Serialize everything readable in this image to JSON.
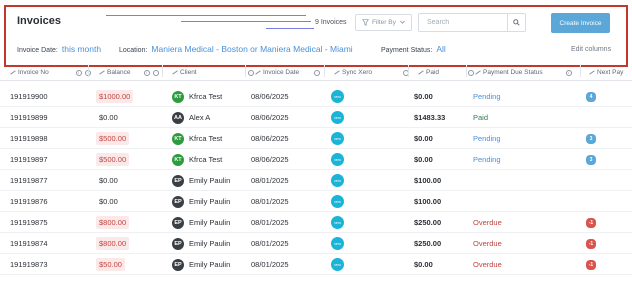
{
  "header": {
    "title": "Invoices",
    "count_label": "9 Invoices",
    "filter_label": "Filter By",
    "search_placeholder": "Search",
    "create_label": "Create Invoice",
    "filters": {
      "invoice_date_label": "Invoice Date:",
      "invoice_date_value": "this month",
      "location_label": "Location:",
      "location_value": "Maniera Medical - Boston or Maniera Medical - Miami",
      "payment_status_label": "Payment Status:",
      "payment_status_value": "All"
    },
    "edit_columns_label": "Edit columns"
  },
  "columns": [
    "Invoice No",
    "Balance",
    "Client",
    "Invoice Date",
    "Sync Xero",
    "Paid",
    "Payment Due Status",
    "Next Pay"
  ],
  "xero_label": "xero",
  "colors": {
    "accent": "#5aa7d8",
    "overdue": "#c2453f",
    "pending": "#4a90d9",
    "paid": "#2e7d4f",
    "avatar_green": "#2e9b3e",
    "avatar_dark": "#3a3f45"
  },
  "rows": [
    {
      "invoice_no": "191919900",
      "balance": "$1000.00",
      "balance_due": true,
      "initials": "KT",
      "avatar": "green",
      "client": "Kfrca Test",
      "date": "08/06/2025",
      "paid": "$0.00",
      "status": "Pending",
      "status_kind": "pending",
      "badge": "4",
      "badge_kind": "blue"
    },
    {
      "invoice_no": "191919899",
      "balance": "$0.00",
      "balance_due": false,
      "initials": "AA",
      "avatar": "dark",
      "client": "Alex A",
      "date": "08/06/2025",
      "paid": "$1483.33",
      "status": "Paid",
      "status_kind": "paid",
      "badge": "",
      "badge_kind": ""
    },
    {
      "invoice_no": "191919898",
      "balance": "$500.00",
      "balance_due": true,
      "initials": "KT",
      "avatar": "green",
      "client": "Kfrca Test",
      "date": "08/06/2025",
      "paid": "$0.00",
      "status": "Pending",
      "status_kind": "pending",
      "badge": "3",
      "badge_kind": "blue"
    },
    {
      "invoice_no": "191919897",
      "balance": "$500.00",
      "balance_due": true,
      "initials": "KT",
      "avatar": "green",
      "client": "Kfrca Test",
      "date": "08/06/2025",
      "paid": "$0.00",
      "status": "Pending",
      "status_kind": "pending",
      "badge": "3",
      "badge_kind": "blue"
    },
    {
      "invoice_no": "191919877",
      "balance": "$0.00",
      "balance_due": false,
      "initials": "EP",
      "avatar": "dark",
      "client": "Emily Paulin",
      "date": "08/01/2025",
      "paid": "$100.00",
      "status": "",
      "status_kind": "",
      "badge": "",
      "badge_kind": ""
    },
    {
      "invoice_no": "191919876",
      "balance": "$0.00",
      "balance_due": false,
      "initials": "EP",
      "avatar": "dark",
      "client": "Emily Paulin",
      "date": "08/01/2025",
      "paid": "$100.00",
      "status": "",
      "status_kind": "",
      "badge": "",
      "badge_kind": ""
    },
    {
      "invoice_no": "191919875",
      "balance": "$800.00",
      "balance_due": true,
      "initials": "EP",
      "avatar": "dark",
      "client": "Emily Paulin",
      "date": "08/01/2025",
      "paid": "$250.00",
      "status": "Overdue",
      "status_kind": "overdue",
      "badge": "-1",
      "badge_kind": "red"
    },
    {
      "invoice_no": "191919874",
      "balance": "$800.00",
      "balance_due": true,
      "initials": "EP",
      "avatar": "dark",
      "client": "Emily Paulin",
      "date": "08/01/2025",
      "paid": "$250.00",
      "status": "Overdue",
      "status_kind": "overdue",
      "badge": "-1",
      "badge_kind": "red"
    },
    {
      "invoice_no": "191919873",
      "balance": "$50.00",
      "balance_due": true,
      "initials": "EP",
      "avatar": "dark",
      "client": "Emily Paulin",
      "date": "08/01/2025",
      "paid": "$0.00",
      "status": "Overdue",
      "status_kind": "overdue",
      "badge": "-1",
      "badge_kind": "red"
    }
  ]
}
